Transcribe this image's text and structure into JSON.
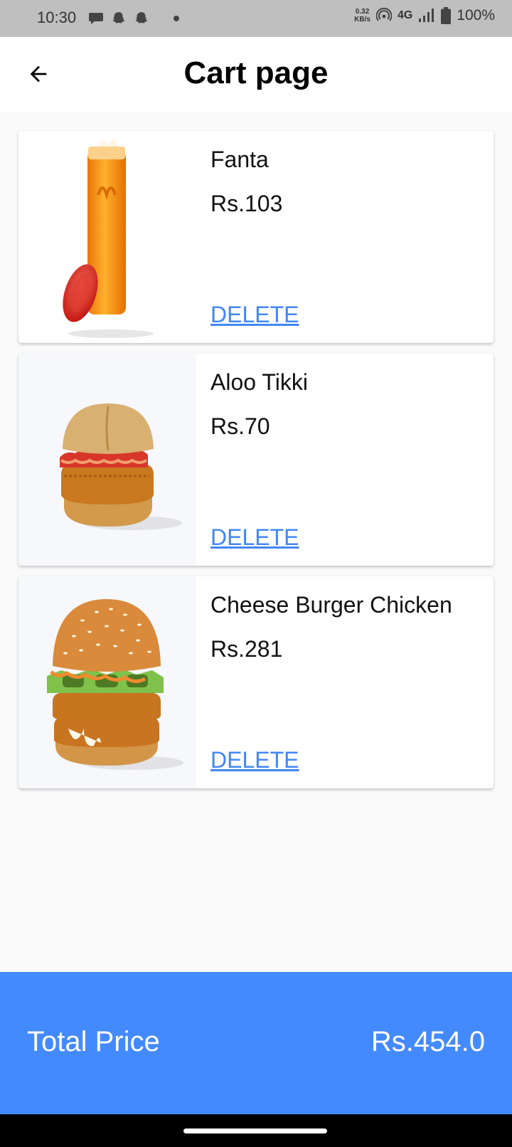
{
  "status_bar": {
    "time": "10:30",
    "speed_value": "0.32",
    "speed_unit": "KB/s",
    "network": "4G",
    "battery": "100%"
  },
  "app_bar": {
    "title": "Cart page",
    "back_icon": "arrow-left-icon"
  },
  "cart": {
    "items": [
      {
        "name": "Fanta",
        "price": "Rs.103",
        "delete_label": "DELETE",
        "image": "fanta-drink"
      },
      {
        "name": "Aloo Tikki",
        "price": "Rs.70",
        "delete_label": "DELETE",
        "image": "aloo-tikki-burger"
      },
      {
        "name": "Cheese Burger Chicken",
        "price": "Rs.281",
        "delete_label": "DELETE",
        "image": "cheese-burger-chicken"
      }
    ]
  },
  "footer": {
    "total_label": "Total Price",
    "total_value": "Rs.454.0"
  },
  "colors": {
    "accent": "#448aff",
    "link": "#4287f5"
  }
}
